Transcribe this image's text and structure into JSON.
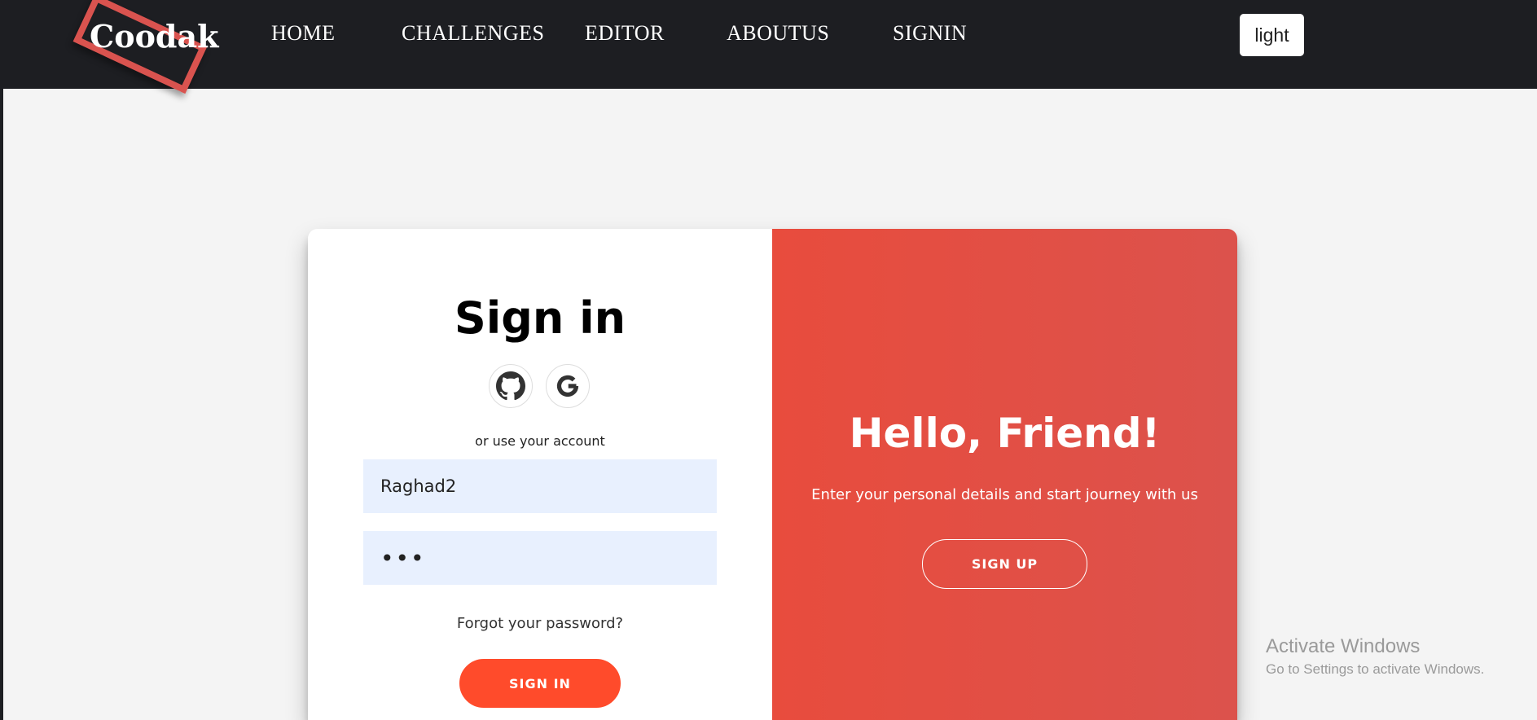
{
  "logo": {
    "text": "Coodak"
  },
  "nav": {
    "items": [
      {
        "label": "HOME"
      },
      {
        "label": "CHALLENGES"
      },
      {
        "label": "EDITOR"
      },
      {
        "label": "ABOUTUS"
      },
      {
        "label": "SIGNIN"
      }
    ],
    "theme_toggle": "light"
  },
  "signin": {
    "title": "Sign in",
    "social": [
      "github-icon",
      "google-icon"
    ],
    "or_text": "or use your account",
    "username_value": "Raghad2",
    "password_value": "•••",
    "forgot": "Forgot your password?",
    "button": "SIGN IN"
  },
  "overlay": {
    "title": "Hello, Friend!",
    "text": "Enter your personal details and start journey with us",
    "button": "SIGN UP"
  },
  "watermark": {
    "title": "Activate Windows",
    "subtitle": "Go to Settings to activate Windows."
  },
  "colors": {
    "navbar": "#1d1e22",
    "accent": "#ff4b2b",
    "overlay": "#e44d44",
    "input_bg": "#e8f0fe",
    "logo_box": "#d9534f"
  }
}
